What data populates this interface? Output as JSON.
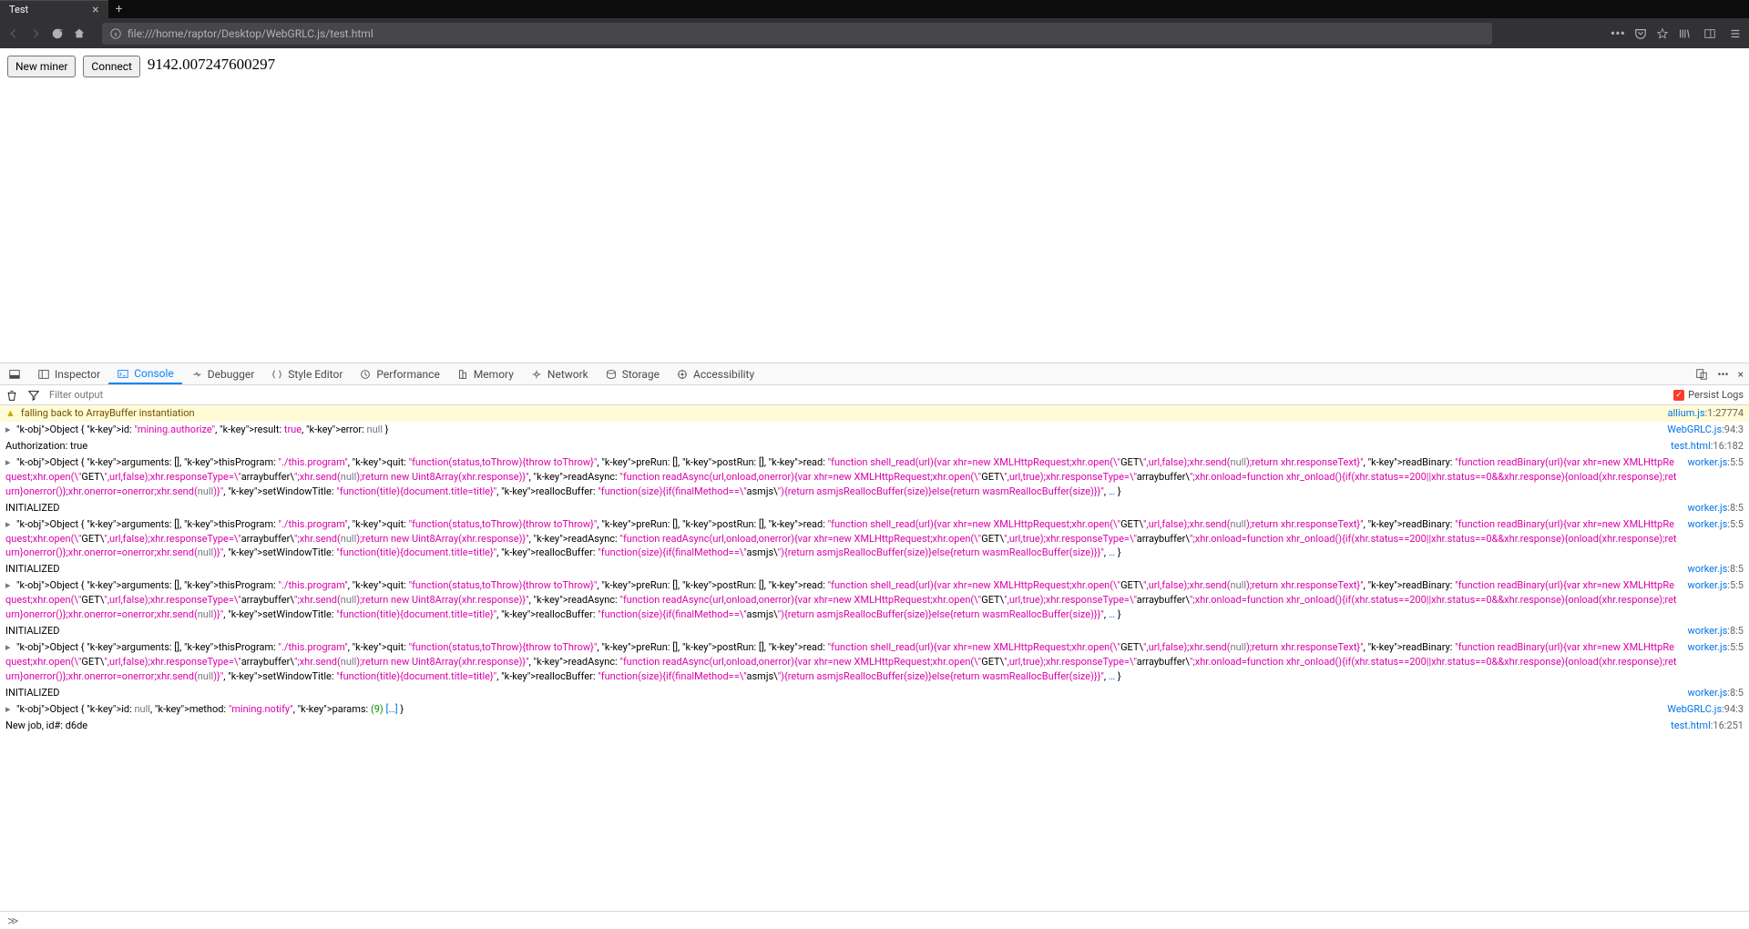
{
  "tab": {
    "title": "Test"
  },
  "url": "file:///home/raptor/Desktop/WebGRLC.js/test.html",
  "page": {
    "btn_newminer": "New miner",
    "btn_connect": "Connect",
    "counter": "9142.007247600297"
  },
  "devtools": {
    "tabs": [
      "Inspector",
      "Console",
      "Debugger",
      "Style Editor",
      "Performance",
      "Memory",
      "Network",
      "Storage",
      "Accessibility"
    ],
    "active": 1,
    "filter_placeholder": "Filter output",
    "persist": "Persist Logs"
  },
  "sources": {
    "allium": "allium.js:1:27774",
    "webgrlc94": "WebGRLC.js:94:3",
    "test_auth": "test.html:16:182",
    "workerA": "worker.js:5:5",
    "workerB": "worker.js:8:5",
    "test_job": "test.html:16:251"
  },
  "log": {
    "warn": "falling back to ArrayBuffer instantiation",
    "auth_obj": "Object { id: \"mining.authorize\", result: true, error: null }",
    "auth_line": "Authorization: true",
    "module_obj": "Object { arguments: [], thisProgram: \"./this.program\", quit: \"function(status,toThrow){throw toThrow}\", preRun: [], postRun: [], read: \"function shell_read(url){var xhr=new XMLHttpRequest;xhr.open(\\\"GET\\\",url,false);xhr.send(null);return xhr.responseText}\", readBinary: \"function readBinary(url){var xhr=new XMLHttpRequest;xhr.open(\\\"GET\\\",url,false);xhr.responseType=\\\"arraybuffer\\\";xhr.send(null);return new Uint8Array(xhr.response)}\", readAsync: \"function readAsync(url,onload,onerror){var xhr=new XMLHttpRequest;xhr.open(\\\"GET\\\",url,true);xhr.responseType=\\\"arraybuffer\\\";xhr.onload=function xhr_onload(){if(xhr.status==200||xhr.status==0&&xhr.response){onload(xhr.response);return}onerror()};xhr.onerror=onerror;xhr.send(null)}\", setWindowTitle: \"function(title){document.title=title}\", reallocBuffer: \"function(size){if(finalMethod==\\\"asmjs\\\"){return asmjsReallocBuffer(size)}else{return wasmReallocBuffer(size)}}\", … }",
    "init": "INITIALIZED",
    "notify_obj": "Object { id: null, method: \"mining.notify\", params: (9) […] }",
    "newjob": "New job, id#: d6de"
  }
}
